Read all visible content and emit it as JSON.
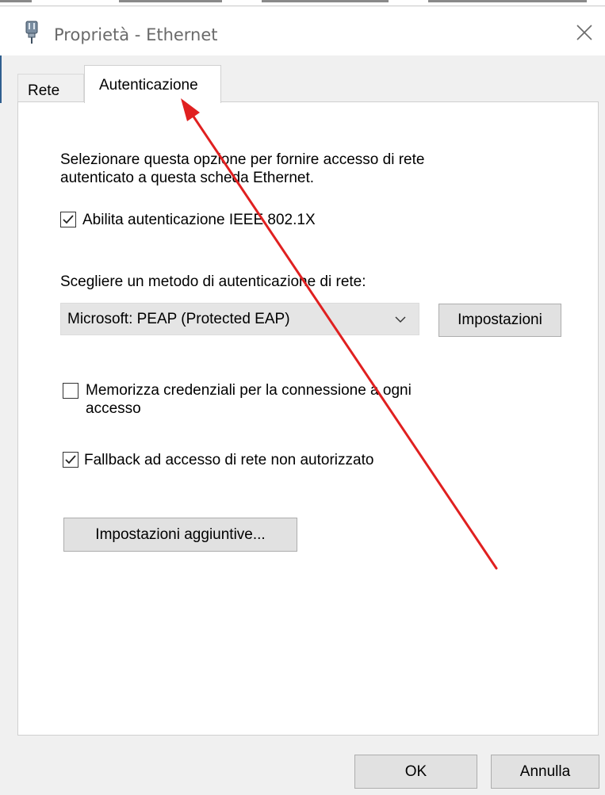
{
  "window": {
    "title": "Proprietà - Ethernet",
    "icon": "network-adapter-icon",
    "close_icon": "close-icon"
  },
  "tabs": [
    {
      "label": "Rete",
      "selected": false
    },
    {
      "label": "Autenticazione",
      "selected": true
    }
  ],
  "auth": {
    "description_line1": "Selezionare questa opzione per fornire accesso di rete",
    "description_line2": "autenticato a questa scheda Ethernet.",
    "enable_8021x": {
      "label": "Abilita autenticazione IEEE 802.1X",
      "checked": true
    },
    "method_label": "Scegliere un metodo di autenticazione di rete:",
    "method_select": {
      "value": "Microsoft: PEAP (Protected EAP)"
    },
    "settings_button": "Impostazioni",
    "remember_credentials": {
      "label_line1": "Memorizza credenziali per la connessione a ogni",
      "label_line2": "accesso",
      "checked": false
    },
    "fallback": {
      "label": "Fallback ad accesso di rete non autorizzato",
      "checked": true
    },
    "additional_settings_button": "Impostazioni aggiuntive..."
  },
  "footer": {
    "ok_label": "OK",
    "cancel_label": "Annulla"
  },
  "colors": {
    "annotation_arrow": "#e02020",
    "selected_field": "#e5e5e5",
    "button_face": "#e1e1e1"
  }
}
